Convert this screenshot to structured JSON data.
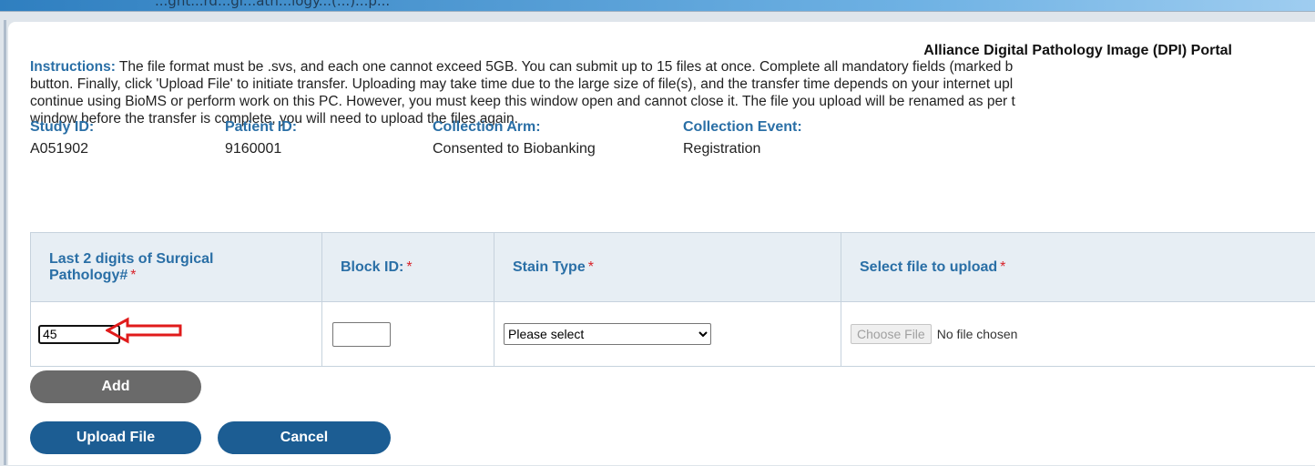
{
  "browser": {
    "top_text": "...ght...rd...gi...ath...logy...(...)...p..."
  },
  "portal": {
    "title": "Alliance Digital Pathology Image (DPI) Portal"
  },
  "instructions": {
    "label": "Instructions:",
    "line1": " The file format must be .svs, and each one cannot exceed 5GB. You can submit up to 15 files at once. Complete all mandatory fields (marked b",
    "line2": "button. Finally, click 'Upload File' to initiate transfer. Uploading may take time due to the large size of file(s), and the transfer time depends on your internet upl",
    "line3": "continue using BioMS or perform work on this PC. However, you must keep this window open and cannot close it. The file you upload will be renamed as per t",
    "line4": "window before the transfer is complete, you will need to upload the files again."
  },
  "info": {
    "study_id_label": "Study ID:",
    "study_id": "A051902",
    "patient_id_label": "Patient ID:",
    "patient_id": "9160001",
    "collection_arm_label": "Collection Arm:",
    "collection_arm": "Consented to Biobanking",
    "collection_event_label": "Collection Event:",
    "collection_event": "Registration"
  },
  "table": {
    "col_pathology": "Last 2 digits of Surgical Pathology#",
    "col_block": "Block ID:",
    "col_stain": "Stain Type",
    "col_file": "Select file to upload",
    "required_marker": "*",
    "row": {
      "pathology_value": "45",
      "block_value": "",
      "stain_selected": "Please select",
      "choose_file_label": "Choose File",
      "file_status": "No file chosen"
    }
  },
  "buttons": {
    "add": "Add",
    "upload": "Upload File",
    "cancel": "Cancel"
  },
  "colors": {
    "accent": "#2a6fa6",
    "button_primary": "#1c5d93",
    "button_secondary": "#6a6a6a",
    "required": "#d8232a",
    "annotation_arrow": "#e01b1b"
  },
  "icons": {
    "annotation": "left-arrow-icon"
  }
}
